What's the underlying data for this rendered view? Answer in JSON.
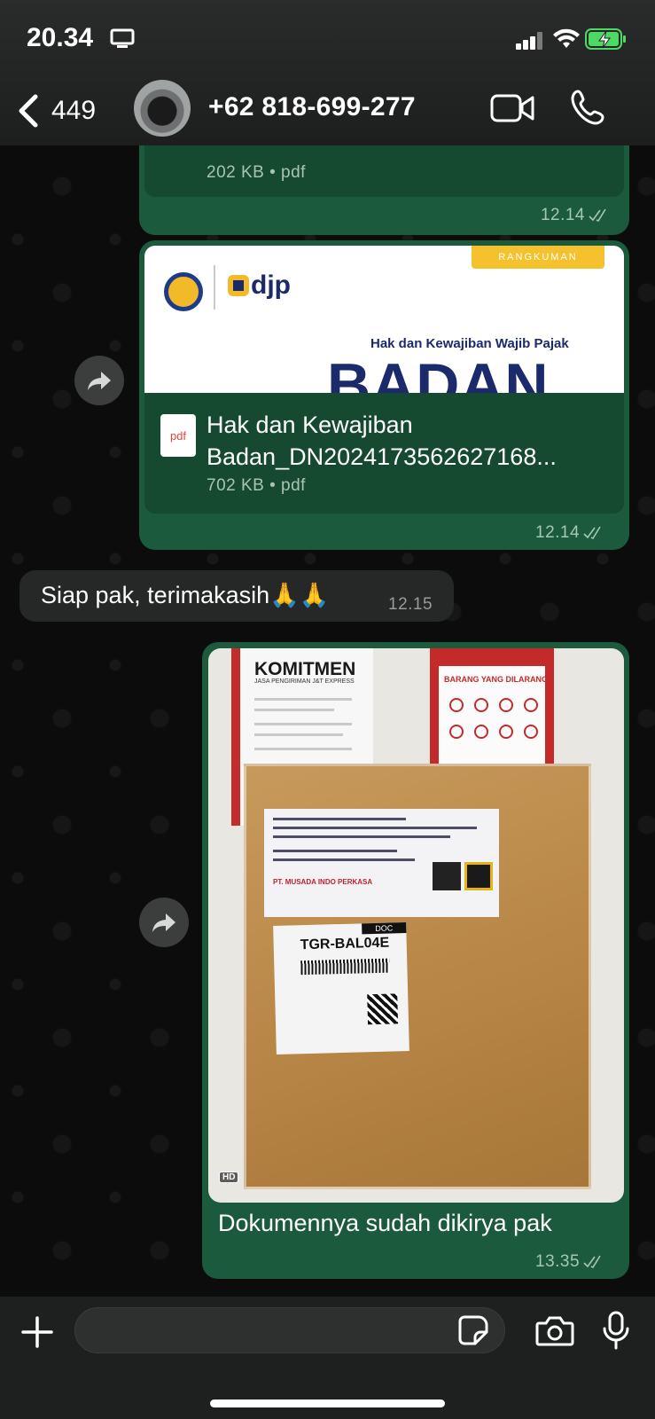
{
  "status_bar": {
    "time": "20.34",
    "icons": [
      "screen-mirroring-icon",
      "signal-icon",
      "wifi-icon",
      "battery-charging-icon"
    ]
  },
  "header": {
    "back_count": "449",
    "contact_name": "+62 818-699-277",
    "icons": [
      "chevron-left-icon",
      "video-call-icon",
      "phone-call-icon"
    ]
  },
  "messages": [
    {
      "type": "file",
      "direction": "out",
      "file_meta": "202 KB • pdf",
      "time": "12.14"
    },
    {
      "type": "file_with_preview",
      "direction": "out",
      "preview": {
        "badge": "RANGKUMAN",
        "brand": "djp",
        "subtitle": "Hak dan Kewajiban Wajib Pajak",
        "title": "BADAN"
      },
      "file_icon_label": "pdf",
      "file_name_line1": "Hak dan Kewajiban",
      "file_name_line2": "Badan_DN2024173562627168...",
      "file_meta": "702 KB • pdf",
      "time": "12.14"
    },
    {
      "type": "text",
      "direction": "in",
      "text": "Siap pak, terimakasih🙏🙏",
      "time": "12.15"
    },
    {
      "type": "photo",
      "direction": "out",
      "photo_texts": {
        "poster1_title": "KOMITMEN",
        "poster1_sub": "JASA PENGIRIMAN J&T EXPRESS",
        "poster2_title": "BARANG YANG DILARANG",
        "label_sender": "PT. MUSADA INDO PERKASA",
        "tracking_code": "TGR-BAL04E",
        "doc_badge": "DOC",
        "hd_badge": "HD"
      },
      "caption": "Dokumennya sudah dikirya pak",
      "time": "13.35"
    }
  ],
  "composer": {
    "placeholder": "",
    "icons": [
      "plus-icon",
      "sticker-icon",
      "camera-icon",
      "microphone-icon"
    ]
  },
  "colors": {
    "outgoing_bubble": "#1b5a3c",
    "incoming_bubble": "#262727",
    "background": "#0b0b0b"
  }
}
